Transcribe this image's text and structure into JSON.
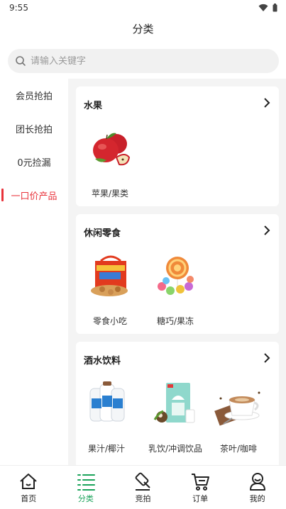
{
  "status_bar": {
    "time": "9:55"
  },
  "header": {
    "title": "分类"
  },
  "search": {
    "placeholder": "请输入关键字"
  },
  "sidebar": {
    "items": [
      {
        "label": "会员抢拍"
      },
      {
        "label": "团长抢拍"
      },
      {
        "label": "0元捡漏"
      },
      {
        "label": "一口价产品"
      }
    ],
    "active_index": 3
  },
  "sections": [
    {
      "title": "水果",
      "items": [
        {
          "label": "苹果/果类",
          "icon": "apple-image"
        }
      ]
    },
    {
      "title": "休闲零食",
      "items": [
        {
          "label": "零食小吃",
          "icon": "snacks-image"
        },
        {
          "label": "糖巧/果冻",
          "icon": "candy-image"
        }
      ]
    },
    {
      "title": "酒水饮料",
      "items": [
        {
          "label": "果汁/椰汁",
          "icon": "coconut-juice-image"
        },
        {
          "label": "乳饮/冲调饮品",
          "icon": "milk-drink-image"
        },
        {
          "label": "茶叶/咖啡",
          "icon": "coffee-image"
        }
      ]
    }
  ],
  "tabbar": {
    "items": [
      {
        "label": "首页",
        "icon": "home-icon"
      },
      {
        "label": "分类",
        "icon": "category-icon"
      },
      {
        "label": "竞拍",
        "icon": "auction-icon"
      },
      {
        "label": "订单",
        "icon": "cart-icon"
      },
      {
        "label": "我的",
        "icon": "user-icon"
      }
    ],
    "active_index": 1
  },
  "colors": {
    "accent_red": "#e8323a",
    "accent_green": "#1aa35a",
    "content_bg": "#f4f4f4"
  }
}
